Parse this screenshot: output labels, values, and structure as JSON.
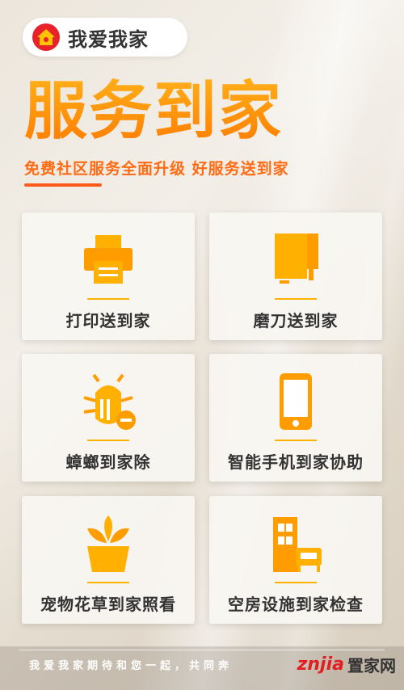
{
  "brand": {
    "name": "我爱我家",
    "logo_color": "#e8222a"
  },
  "hero": {
    "title": "服务到家",
    "subtitle": "免费社区服务全面升级  好服务送到家"
  },
  "services": [
    {
      "label": "打印送到家",
      "icon": "printer-icon"
    },
    {
      "label": "磨刀送到家",
      "icon": "knife-sharpening-icon"
    },
    {
      "label": "蟑螂到家除",
      "icon": "bug-icon"
    },
    {
      "label": "智能手机到家协助",
      "icon": "smartphone-icon"
    },
    {
      "label": "宠物花草到家照看",
      "icon": "plant-pot-icon"
    },
    {
      "label": "空房设施到家检查",
      "icon": "furniture-icon"
    }
  ],
  "footer": {
    "slogan": "我爱我家期待和您一起，共同奔",
    "watermark_latin": "znjia",
    "watermark_cn": "置家网"
  },
  "colors": {
    "accent": "#ff8a00",
    "accent_dark": "#ff6a12",
    "icon": "#ff9d00"
  }
}
